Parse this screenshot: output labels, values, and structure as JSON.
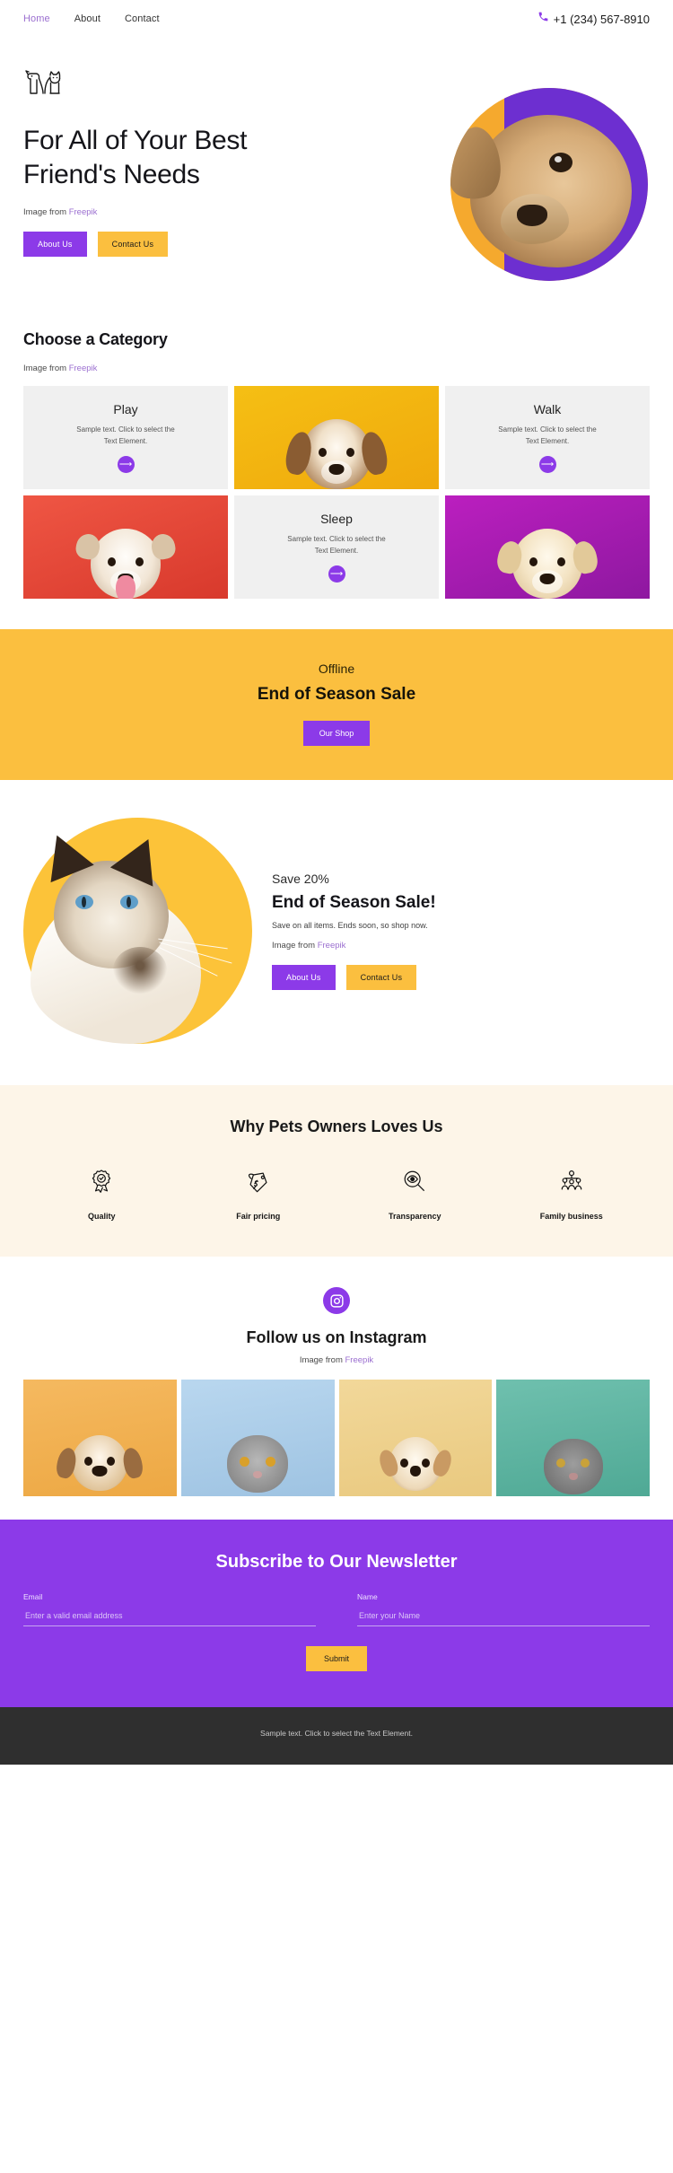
{
  "nav": {
    "links": [
      {
        "label": "Home",
        "active": true
      },
      {
        "label": "About",
        "active": false
      },
      {
        "label": "Contact",
        "active": false
      }
    ],
    "phone": "+1 (234) 567-8910",
    "phone_icon": "phone-icon"
  },
  "hero": {
    "logo_icon": "dog-cat-logo-icon",
    "title": "For All of Your Best Friend's Needs",
    "credit_prefix": "Image from ",
    "credit_link": "Freepik",
    "primary_button": "About Us",
    "secondary_button": "Contact Us"
  },
  "category": {
    "heading": "Choose a Category",
    "credit_prefix": "Image from ",
    "credit_link": "Freepik",
    "sample_text": "Sample text. Click to select the Text Element.",
    "arrow_icon": "arrow-right-icon",
    "cards": [
      {
        "type": "text",
        "title": "Play"
      },
      {
        "type": "photo",
        "title": "",
        "image": "beagle-puppy-yellow-background"
      },
      {
        "type": "text",
        "title": "Walk"
      },
      {
        "type": "photo",
        "title": "",
        "image": "bulldog-red-background"
      },
      {
        "type": "text",
        "title": "Sleep"
      },
      {
        "type": "photo",
        "title": "",
        "image": "golden-retriever-puppy-magenta-background"
      }
    ]
  },
  "sale_band": {
    "kicker": "Offline",
    "title": "End of Season Sale",
    "button": "Our Shop"
  },
  "promo": {
    "image": "siamese-cat-yellow-circle",
    "kicker": "Save 20%",
    "title": "End of Season Sale!",
    "description": "Save on all items. Ends soon, so shop now.",
    "credit_prefix": "Image from ",
    "credit_link": "Freepik",
    "primary_button": "About Us",
    "secondary_button": "Contact Us"
  },
  "why": {
    "heading": "Why Pets Owners Loves Us",
    "items": [
      {
        "label": "Quality",
        "icon": "award-badge-icon"
      },
      {
        "label": "Fair pricing",
        "icon": "price-tag-icon"
      },
      {
        "label": "Transparency",
        "icon": "magnifier-eye-icon"
      },
      {
        "label": "Family business",
        "icon": "family-tree-icon"
      }
    ]
  },
  "instagram": {
    "badge_icon": "instagram-icon",
    "heading": "Follow us on Instagram",
    "credit_prefix": "Image from ",
    "credit_link": "Freepik",
    "gallery": [
      {
        "image": "dog-orange-background"
      },
      {
        "image": "grey-cat-blue-background"
      },
      {
        "image": "chihuahua-beige-background"
      },
      {
        "image": "cat-looking-up-teal-background"
      }
    ]
  },
  "newsletter": {
    "heading": "Subscribe to Our Newsletter",
    "email_label": "Email",
    "email_placeholder": "Enter a valid email address",
    "email_value": "",
    "name_label": "Name",
    "name_placeholder": "Enter your Name",
    "name_value": "",
    "submit_label": "Submit"
  },
  "footer": {
    "text": "Sample text. Click to select the Text Element."
  },
  "colors": {
    "purple": "#8c3ae8",
    "yellow": "#fbbf3f",
    "cream": "#fdf5e8",
    "footer_dark": "#2f2f2f",
    "link_purple": "#9b6fd0"
  }
}
